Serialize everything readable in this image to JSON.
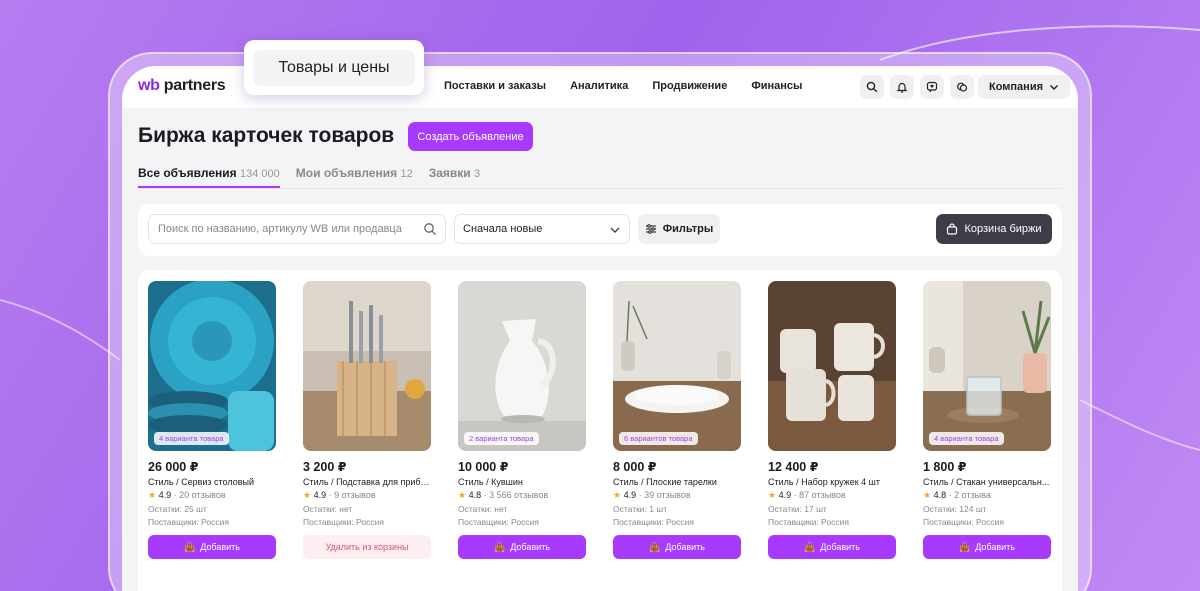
{
  "colors": {
    "accent": "#a73afd",
    "dark_button": "#3d3d47",
    "remove_bg": "#fdeef2",
    "remove_text": "#e0546f",
    "star": "#f5a623"
  },
  "header": {
    "logo_prefix": "wb",
    "logo_suffix": " partners",
    "popup_label": "Товары и цены",
    "nav": [
      "Поставки и заказы",
      "Аналитика",
      "Продвижение",
      "Финансы"
    ],
    "icons": [
      "search-icon",
      "bell-icon",
      "heart-chat-icon",
      "chat-icon"
    ],
    "company_label": "Компания"
  },
  "page": {
    "title": "Биржа карточек товаров",
    "create_button": "Создать объявление",
    "tabs": [
      {
        "label": "Все объявления",
        "count": "134 000",
        "active": true
      },
      {
        "label": "Мои объявления",
        "count": "12",
        "active": false
      },
      {
        "label": "Заявки",
        "count": "3",
        "active": false
      }
    ]
  },
  "filters": {
    "search_placeholder": "Поиск по названию, артикулу WB или продавца",
    "sort_value": "Сначала новые",
    "filters_label": "Фильтры",
    "cart_label": "Корзина биржи"
  },
  "products": [
    {
      "variants": "4 варианта товара",
      "price": "26 000 ₽",
      "name": "Стиль / Сервиз столовый",
      "rating": "4.9",
      "reviews": "· 20 отзывов",
      "stock": "Остатки: 25 шт",
      "suppliers": "Поставщики: Россия",
      "action": "Добавить",
      "in_cart": false,
      "image": "blue-plates"
    },
    {
      "variants": "",
      "price": "3 200 ₽",
      "name": "Стиль / Подставка для прибо...",
      "rating": "4.9",
      "reviews": "· 9 отзывов",
      "stock": "Остатки: нет",
      "suppliers": "Поставщики: Россия",
      "action": "Удалить из корзины",
      "in_cart": true,
      "image": "cutlery-stand"
    },
    {
      "variants": "2 варианта товара",
      "price": "10 000 ₽",
      "name": "Стиль / Кувшин",
      "rating": "4.8",
      "reviews": "· 3 566 отзывов",
      "stock": "Остатки: нет",
      "suppliers": "Поставщики: Россия",
      "action": "Добавить",
      "in_cart": false,
      "image": "white-jug"
    },
    {
      "variants": "6 вариантов товара",
      "price": "8 000 ₽",
      "name": "Стиль / Плоские тарелки",
      "rating": "4.9",
      "reviews": "· 39 отзывов",
      "stock": "Остатки: 1 шт",
      "suppliers": "Поставщики: Россия",
      "action": "Добавить",
      "in_cart": false,
      "image": "flat-plates"
    },
    {
      "variants": "",
      "price": "12 400 ₽",
      "name": "Стиль / Набор кружек 4 шт",
      "rating": "4.9",
      "reviews": "· 87 отзывов",
      "stock": "Остатки: 17 шт",
      "suppliers": "Поставщики: Россия",
      "action": "Добавить",
      "in_cart": false,
      "image": "mugs"
    },
    {
      "variants": "4 варианта товара",
      "price": "1 800 ₽",
      "name": "Стиль / Стакан универсальн...",
      "rating": "4.8",
      "reviews": "· 2 отзыва",
      "stock": "Остатки: 124 шт",
      "suppliers": "Поставщики: Россия",
      "action": "Добавить",
      "in_cart": false,
      "image": "glass"
    }
  ]
}
